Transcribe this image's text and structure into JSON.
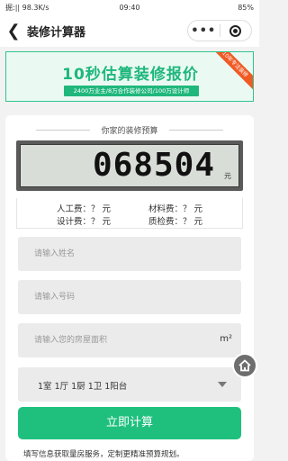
{
  "status_bar": {
    "left": "掘:|| 98.3K/s",
    "time": "09:40",
    "right": "85%"
  },
  "nav": {
    "title": "装修计算器",
    "more_label": "•••"
  },
  "banner": {
    "title": "10秒估算装修报价",
    "subtitle": "2400万业主/8万合作装修公司/100万设计师",
    "ribbon": "10年专注装修"
  },
  "budget": {
    "caption": "你家的装修预算",
    "amount": "068504",
    "unit": "元"
  },
  "fees": {
    "labor": "人工费：？ 元",
    "material": "材料费：？ 元",
    "design": "设计费：？ 元",
    "inspection": "质检费：？ 元"
  },
  "form": {
    "name_placeholder": "请输入姓名",
    "phone_placeholder": "请输入号码",
    "area_placeholder": "请输入您的房屋面积",
    "area_unit": "m²",
    "room_layout": "1室 1厅 1厨 1卫 1阳台"
  },
  "actions": {
    "calculate_label": "立即计算"
  },
  "footer": {
    "hint": "填写信息获取量房服务，定制更精准预算规划。"
  },
  "colors": {
    "accent": "#1fc07e",
    "ribbon": "#f05a24"
  }
}
